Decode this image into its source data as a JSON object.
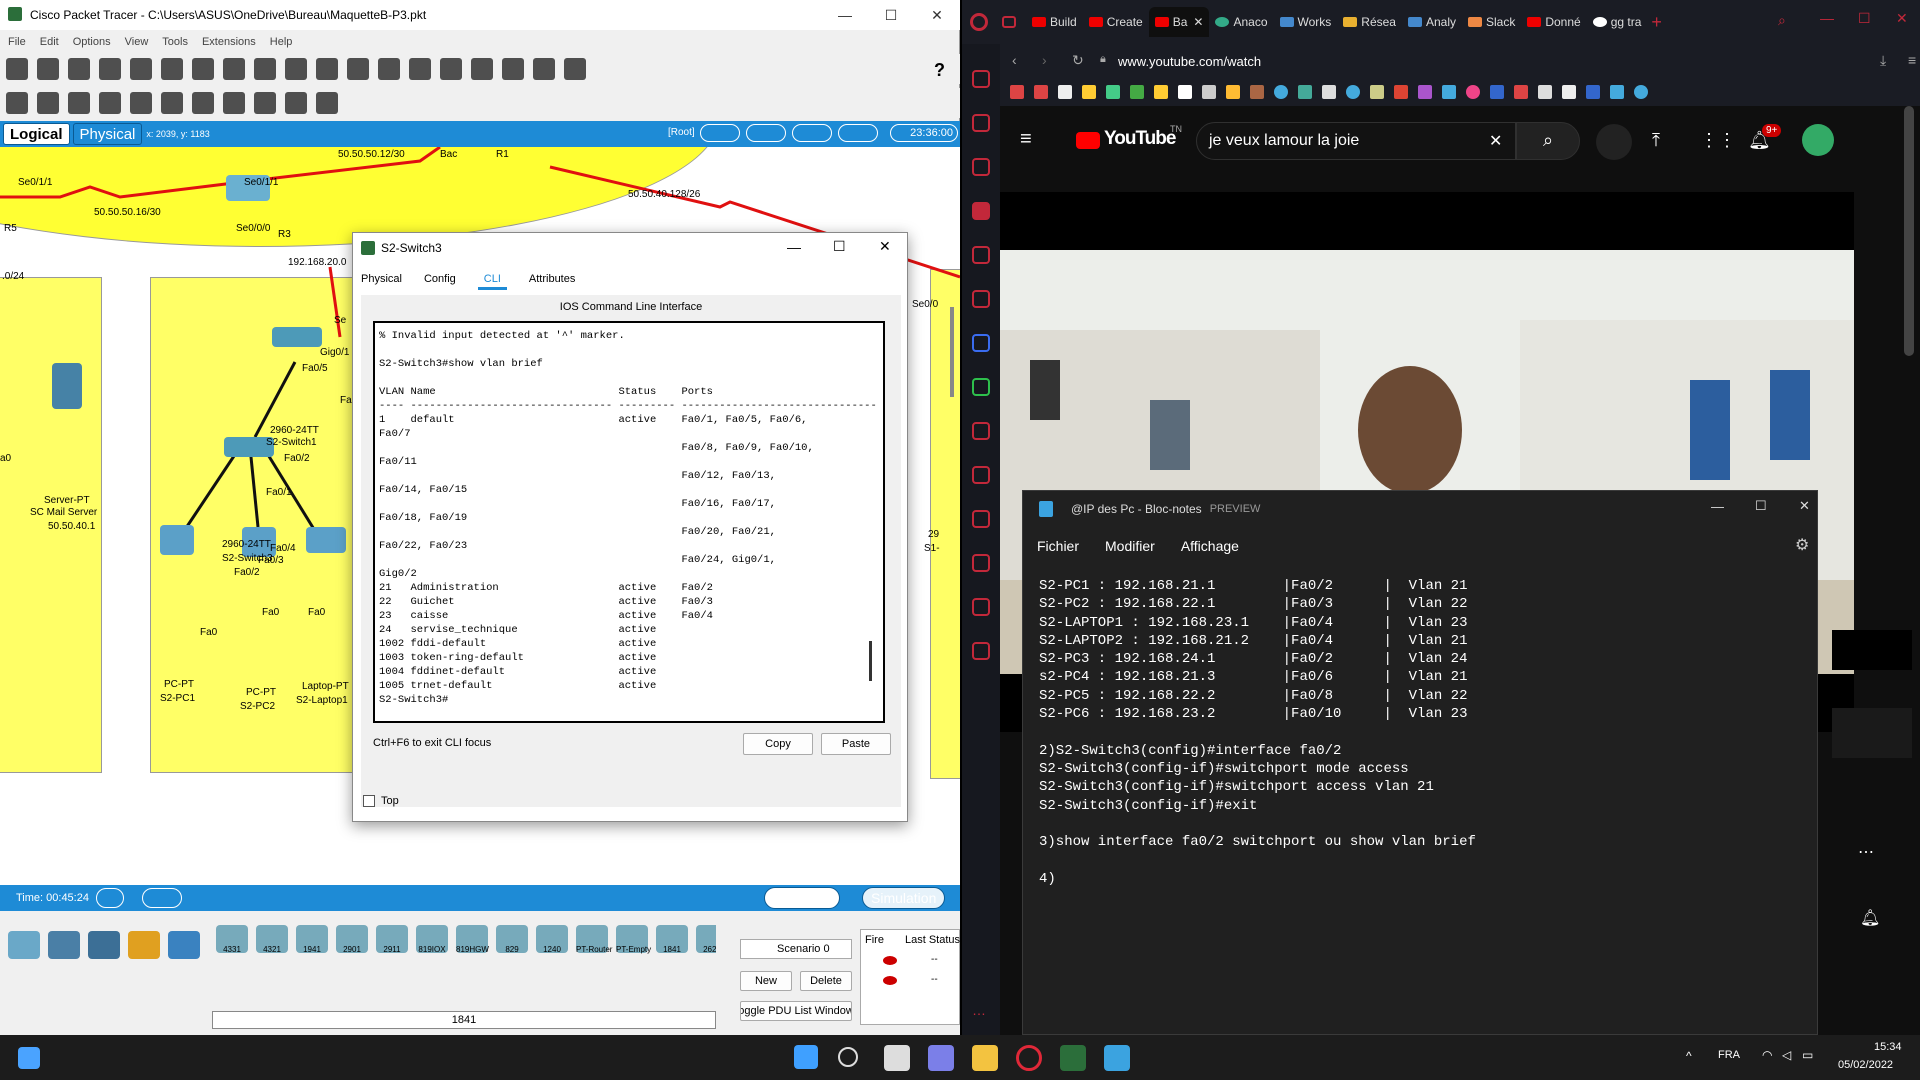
{
  "pt": {
    "title": "Cisco Packet Tracer - C:\\Users\\ASUS\\OneDrive\\Bureau\\MaquetteB-P3.pkt",
    "menu": [
      "File",
      "Edit",
      "Options",
      "View",
      "Tools",
      "Extensions",
      "Help"
    ],
    "tabs": {
      "logical": "Logical",
      "physical": "Physical",
      "coords": "x: 2039, y: 1183",
      "root": "[Root]",
      "clock": "23:36:00"
    },
    "canvas_labels": [
      "Se0/1/1",
      "Se0/1/1",
      "50.50.50.12/30",
      "Bac",
      "R1",
      "50.50.50.16/30",
      "Se0/0/0",
      "R5",
      "R3",
      "192.168.20.0",
      "50.50.40.128/26",
      "Se0/0",
      "Se",
      "Gig0/1",
      "Fa0/5",
      "Fa",
      "2960-24TT",
      "S2-Switch1",
      "Fa0/2",
      "Fa0/1",
      "2960-24TT",
      "S2-Switch3",
      "Fa0/4",
      "Fa0/3",
      "Fa0/2",
      "Fa0",
      "Fa0",
      "Fa0",
      "a0",
      "Server-PT",
      "SC Mail Server",
      "50.50.40.1",
      "PC-PT",
      "S2-PC1",
      "PC-PT",
      "S2-PC2",
      "Laptop-PT",
      "S2-Laptop1",
      "29",
      "S1-",
      ".0/24"
    ],
    "time": "Time: 00:45:24",
    "realtime": "Realtime",
    "simulation": "Simulation",
    "device_models": [
      "4331",
      "4321",
      "1941",
      "2901",
      "2911",
      "819IOX",
      "819HGW",
      "829",
      "1240",
      "PT-Router",
      "PT-Empty",
      "1841",
      "2620"
    ],
    "selected_model": "1841",
    "scenario": "Scenario 0",
    "new_btn": "New",
    "delete_btn": "Delete",
    "pdu_btn": "oggle PDU List Window",
    "fire_col": "Fire",
    "last_status_col": "Last Status",
    "status_dash": "--"
  },
  "dialog": {
    "title": "S2-Switch3",
    "tabs": [
      "Physical",
      "Config",
      "CLI",
      "Attributes"
    ],
    "header": "IOS Command Line Interface",
    "cli": "% Invalid input detected at '^' marker.\n\nS2-Switch3#show vlan brief\n\nVLAN Name                             Status    Ports\n---- -------------------------------- --------- -------------------------------\n1    default                          active    Fa0/1, Fa0/5, Fa0/6,\nFa0/7\n                                                Fa0/8, Fa0/9, Fa0/10,\nFa0/11\n                                                Fa0/12, Fa0/13,\nFa0/14, Fa0/15\n                                                Fa0/16, Fa0/17,\nFa0/18, Fa0/19\n                                                Fa0/20, Fa0/21,\nFa0/22, Fa0/23\n                                                Fa0/24, Gig0/1,\nGig0/2\n21   Administration                   active    Fa0/2\n22   Guichet                          active    Fa0/3\n23   caisse                           active    Fa0/4\n24   servise_technique                active\n1002 fddi-default                     active\n1003 token-ring-default               active\n1004 fddinet-default                  active\n1005 trnet-default                    active\nS2-Switch3#",
    "hint": "Ctrl+F6 to exit CLI focus",
    "copy": "Copy",
    "paste": "Paste",
    "top": "Top"
  },
  "browser": {
    "tabs": [
      "Build",
      "Create",
      "Ba",
      "Anaco",
      "Works",
      "Résea",
      "Analy",
      "Slack",
      "Donné",
      "gg tra"
    ],
    "url": "www.youtube.com/watch",
    "search_query": "je veux lamour la joie",
    "notif_count": "9+",
    "yt_logo": "YouTube",
    "yt_tn": "TN"
  },
  "notepad": {
    "title": "@IP des Pc - Bloc-notes",
    "preview": "PREVIEW",
    "menu": [
      "Fichier",
      "Modifier",
      "Affichage"
    ],
    "text": "S2-PC1 : 192.168.21.1        |Fa0/2      |  Vlan 21\nS2-PC2 : 192.168.22.1        |Fa0/3      |  Vlan 22\nS2-LAPTOP1 : 192.168.23.1    |Fa0/4      |  Vlan 23\nS2-LAPTOP2 : 192.168.21.2    |Fa0/4      |  Vlan 21\nS2-PC3 : 192.168.24.1        |Fa0/2      |  Vlan 24\ns2-PC4 : 192.168.21.3        |Fa0/6      |  Vlan 21\nS2-PC5 : 192.168.22.2        |Fa0/8      |  Vlan 22\nS2-PC6 : 192.168.23.2        |Fa0/10     |  Vlan 23\n\n2)S2-Switch3(config)#interface fa0/2\nS2-Switch3(config-if)#switchport mode access\nS2-Switch3(config-if)#switchport access vlan 21\nS2-Switch3(config-if)#exit\n\n3)show interface fa0/2 switchport ou show vlan brief\n\n4)"
  },
  "taskbar": {
    "lang": "FRA",
    "time": "15:34",
    "date": "05/02/2022"
  },
  "colors": {
    "pt_blue": "#1e8bd6",
    "zone_yellow": "#ffff66",
    "link_red": "#e01010",
    "link_black": "#111111",
    "yt_red": "#ff0000",
    "opera_red": "#c2283a"
  }
}
